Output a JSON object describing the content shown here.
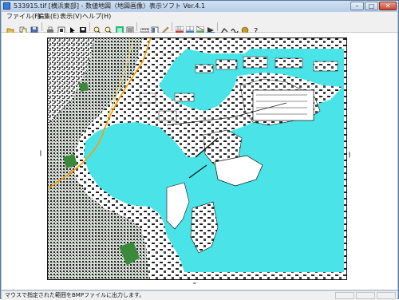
{
  "window": {
    "title": "533915.tif [横浜東部] - 数値地図〈地図画像〉表示ソフト Ver.4.1"
  },
  "menu": {
    "items": [
      "ファイル(F)",
      "編集(E)",
      "表示(V)",
      "ヘルプ(H)"
    ]
  },
  "toolbar": {
    "buttons": [
      "open-icon",
      "copy-icon",
      "save-icon",
      "print-icon",
      "export-icon",
      "cursor-icon",
      "save-disk-icon",
      "zoom-in-icon",
      "zoom-out-icon",
      "map-view-icon",
      "scale-icon",
      "measure-icon",
      "layer-icon",
      "grid-icon",
      "map-grid-icon",
      "mesh-icon",
      "path-icon",
      "curve-icon",
      "color-icon",
      "help-icon"
    ]
  },
  "map": {
    "colors": {
      "water": "#4ae4e8",
      "land": "#ffffff",
      "ink": "#1a1a1a",
      "park": "#3b8a3b",
      "road": "#ff9a00",
      "rail": "#e3d57a"
    }
  },
  "status": {
    "text": "マウスで指定された範囲をBMPファイルに出力します。"
  }
}
